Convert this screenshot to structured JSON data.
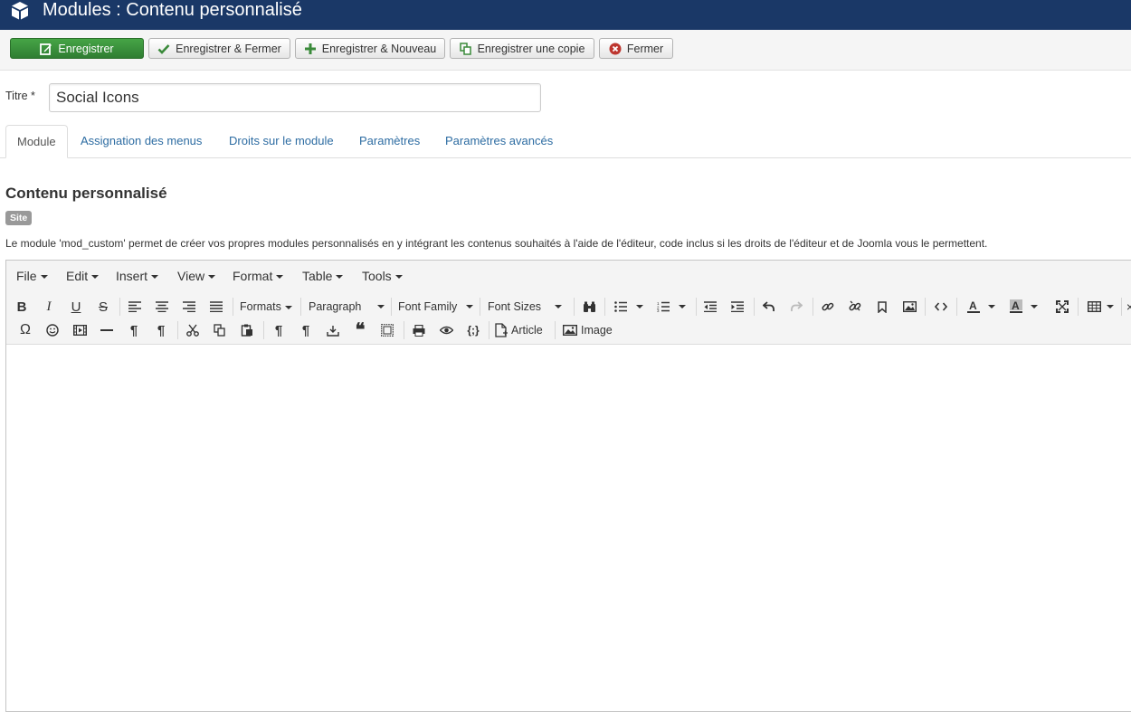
{
  "header": {
    "title": "Modules : Contenu personnalisé"
  },
  "toolbar": {
    "save": "Enregistrer",
    "save_close": "Enregistrer & Fermer",
    "save_new": "Enregistrer & Nouveau",
    "save_copy": "Enregistrer une copie",
    "close": "Fermer"
  },
  "form": {
    "title_label": "Titre *",
    "title_value": "Social Icons"
  },
  "tabs": [
    "Module",
    "Assignation des menus",
    "Droits sur le module",
    "Paramètres",
    "Paramètres avancés"
  ],
  "content": {
    "heading": "Contenu personnalisé",
    "badge": "Site",
    "description": "Le module 'mod_custom' permet de créer vos propres modules personnalisés en y intégrant les contenus souhaités à l'aide de l'éditeur, code inclus si les droits de l'éditeur et de Joomla vous le permettent."
  },
  "editor": {
    "menus": [
      "File",
      "Edit",
      "Insert",
      "View",
      "Format",
      "Table",
      "Tools"
    ],
    "formats": "Formats",
    "paragraph": "Paragraph",
    "font_family": "Font Family",
    "font_sizes": "Font Sizes",
    "article_btn": "Article",
    "image_btn": "Image"
  },
  "colors": {
    "header_bg": "#1a3867",
    "save_green": "#46a546",
    "link_blue": "#2d6ca2"
  }
}
